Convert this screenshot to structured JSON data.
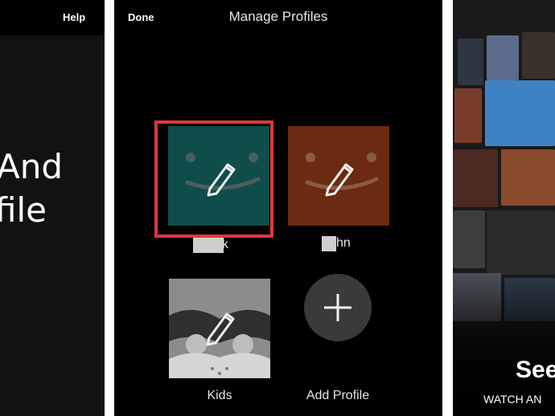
{
  "left_panel": {
    "help_label": "Help",
    "heading_line1": "And",
    "heading_line2": "file"
  },
  "manage": {
    "done_label": "Done",
    "title": "Manage Profiles",
    "profiles": [
      {
        "name": "k",
        "color": "#0f4d4a",
        "selected": true,
        "icon": "pencil-icon"
      },
      {
        "name": "hn",
        "color": "#6b2a11",
        "selected": false,
        "icon": "pencil-icon"
      },
      {
        "name": "Kids",
        "color": "#8c8c8c",
        "selected": false,
        "icon": "pencil-icon"
      }
    ],
    "add_profile_label": "Add Profile",
    "add_icon": "plus-icon",
    "accent": "#e2373a"
  },
  "right_panel": {
    "headline": "See",
    "subline": "WATCH AN"
  }
}
